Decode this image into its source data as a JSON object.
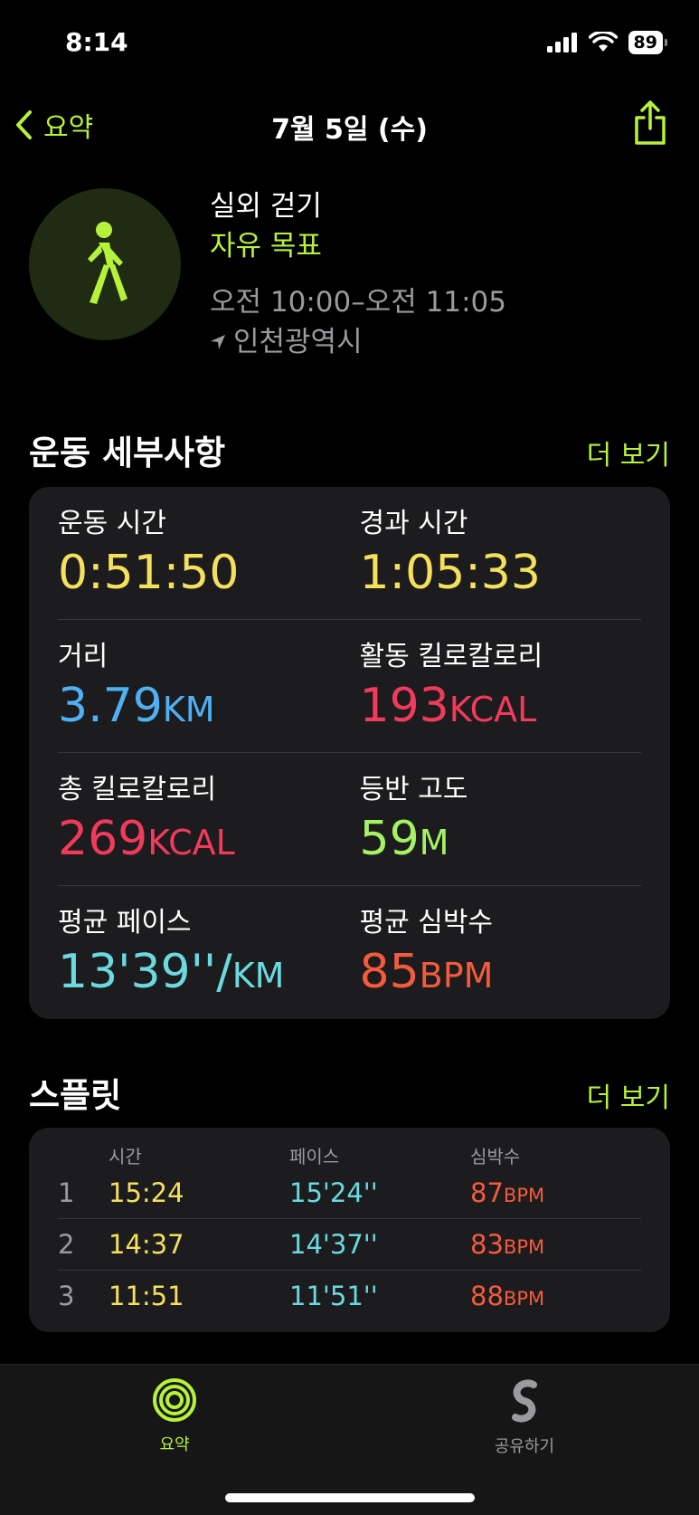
{
  "status": {
    "time": "8:14",
    "battery": "89"
  },
  "nav": {
    "back_label": "요약",
    "title": "7월 5일 (수)"
  },
  "workout": {
    "name": "실외 걷기",
    "goal": "자유 목표",
    "time_range": "오전 10:00–오전 11:05",
    "location": "인천광역시"
  },
  "details": {
    "heading": "운동 세부사항",
    "more": "더 보기",
    "metrics": [
      {
        "label": "운동 시간",
        "value": "0:51:50",
        "unit": "",
        "color": "#f5e05c"
      },
      {
        "label": "경과 시간",
        "value": "1:05:33",
        "unit": "",
        "color": "#f5e05c"
      },
      {
        "label": "거리",
        "value": "3.79",
        "unit": "KM",
        "color": "#4fb0f5"
      },
      {
        "label": "활동 킬로칼로리",
        "value": "193",
        "unit": "KCAL",
        "color": "#f23a5c"
      },
      {
        "label": "총 킬로칼로리",
        "value": "269",
        "unit": "KCAL",
        "color": "#f23a5c"
      },
      {
        "label": "등반 고도",
        "value": "59",
        "unit": "M",
        "color": "#a5f264"
      },
      {
        "label": "평균 페이스",
        "value": "13'39''/",
        "unit": "KM",
        "color": "#6ad9e0"
      },
      {
        "label": "평균 심박수",
        "value": "85",
        "unit": "BPM",
        "color": "#f35b3c"
      }
    ]
  },
  "splits": {
    "heading": "스플릿",
    "more": "더 보기",
    "columns": [
      "시간",
      "페이스",
      "심박수"
    ],
    "rows": [
      {
        "n": "1",
        "time": "15:24",
        "pace": "15'24''",
        "hr": "87",
        "unit": "BPM"
      },
      {
        "n": "2",
        "time": "14:37",
        "pace": "14'37''",
        "hr": "83",
        "unit": "BPM"
      },
      {
        "n": "3",
        "time": "11:51",
        "pace": "11'51''",
        "hr": "88",
        "unit": "BPM"
      }
    ]
  },
  "tabs": [
    {
      "label": "요약",
      "icon": "activity-rings-icon",
      "active": true
    },
    {
      "label": "공유하기",
      "icon": "sharing-icon",
      "active": false
    }
  ],
  "colors": {
    "accent": "#b6f23a"
  }
}
